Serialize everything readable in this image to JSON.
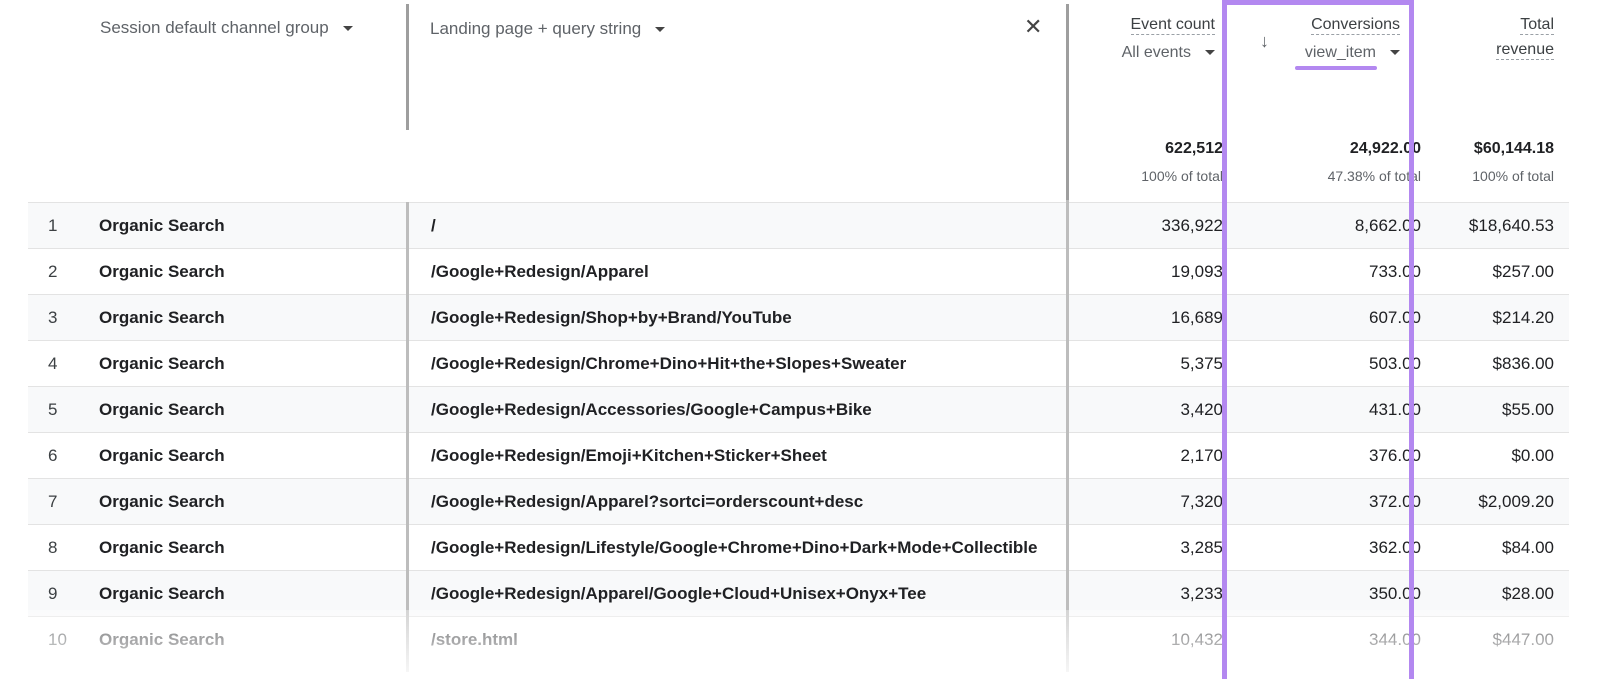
{
  "columns": {
    "channel": {
      "label": "Session default channel group"
    },
    "landing": {
      "label": "Landing page + query string"
    },
    "event_count": {
      "title": "Event count",
      "sub": "All events"
    },
    "conversions": {
      "title": "Conversions",
      "sub": "view_item"
    },
    "revenue": {
      "title_line1": "Total",
      "title_line2": "revenue"
    }
  },
  "totals": {
    "event_count": "622,512",
    "event_count_pct": "100% of total",
    "conversions": "24,922.00",
    "conversions_pct": "47.38% of total",
    "revenue": "$60,144.18",
    "revenue_pct": "100% of total"
  },
  "icons": {
    "close": "close-icon",
    "sort": "arrow-down-icon",
    "dropdown": "dropdown-arrow-icon"
  },
  "colors": {
    "highlight": "#b388f0"
  },
  "rows": [
    {
      "idx": "1",
      "channel": "Organic Search",
      "page": "/",
      "events": "336,922",
      "conv": "8,662.00",
      "rev": "$18,640.53"
    },
    {
      "idx": "2",
      "channel": "Organic Search",
      "page": "/Google+Redesign/Apparel",
      "events": "19,093",
      "conv": "733.00",
      "rev": "$257.00"
    },
    {
      "idx": "3",
      "channel": "Organic Search",
      "page": "/Google+Redesign/Shop+by+Brand/YouTube",
      "events": "16,689",
      "conv": "607.00",
      "rev": "$214.20"
    },
    {
      "idx": "4",
      "channel": "Organic Search",
      "page": "/Google+Redesign/Chrome+Dino+Hit+the+Slopes+Sweater",
      "events": "5,375",
      "conv": "503.00",
      "rev": "$836.00"
    },
    {
      "idx": "5",
      "channel": "Organic Search",
      "page": "/Google+Redesign/Accessories/Google+Campus+Bike",
      "events": "3,420",
      "conv": "431.00",
      "rev": "$55.00"
    },
    {
      "idx": "6",
      "channel": "Organic Search",
      "page": "/Google+Redesign/Emoji+Kitchen+Sticker+Sheet",
      "events": "2,170",
      "conv": "376.00",
      "rev": "$0.00"
    },
    {
      "idx": "7",
      "channel": "Organic Search",
      "page": "/Google+Redesign/Apparel?sortci=orderscount+desc",
      "events": "7,320",
      "conv": "372.00",
      "rev": "$2,009.20"
    },
    {
      "idx": "8",
      "channel": "Organic Search",
      "page": "/Google+Redesign/Lifestyle/Google+Chrome+Dino+Dark+Mode+Collectible",
      "events": "3,285",
      "conv": "362.00",
      "rev": "$84.00"
    },
    {
      "idx": "9",
      "channel": "Organic Search",
      "page": "/Google+Redesign/Apparel/Google+Cloud+Unisex+Onyx+Tee",
      "events": "3,233",
      "conv": "350.00",
      "rev": "$28.00"
    },
    {
      "idx": "10",
      "channel": "Organic Search",
      "page": "/store.html",
      "events": "10,432",
      "conv": "344.00",
      "rev": "$447.00"
    }
  ]
}
